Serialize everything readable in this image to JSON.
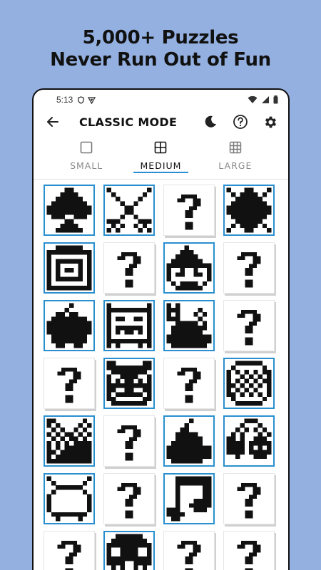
{
  "promo": {
    "line1": "5,000+ Puzzles",
    "line2": "Never Run Out of Fun"
  },
  "status_bar": {
    "time": "5:13",
    "icons": [
      "shield-icon",
      "vpn-icon",
      "wifi-icon",
      "signal-icon",
      "battery-icon"
    ]
  },
  "appbar": {
    "title": "CLASSIC MODE",
    "back_icon": "arrow-left-icon",
    "actions": [
      "dark-mode-icon",
      "help-icon",
      "settings-icon"
    ]
  },
  "tabs": [
    {
      "label": "SMALL",
      "icon": "grid-1-icon",
      "active": false
    },
    {
      "label": "MEDIUM",
      "icon": "grid-2-icon",
      "active": true
    },
    {
      "label": "LARGE",
      "icon": "grid-3-icon",
      "active": false
    }
  ],
  "puzzles": [
    {
      "solved": true,
      "pic": "spade"
    },
    {
      "solved": true,
      "pic": "crossed-swords"
    },
    {
      "solved": false,
      "pic": "?"
    },
    {
      "solved": true,
      "pic": "sun"
    },
    {
      "solved": true,
      "pic": "target-box"
    },
    {
      "solved": false,
      "pic": "?"
    },
    {
      "solved": true,
      "pic": "wizard"
    },
    {
      "solved": false,
      "pic": "?"
    },
    {
      "solved": true,
      "pic": "apple"
    },
    {
      "solved": true,
      "pic": "robot"
    },
    {
      "solved": true,
      "pic": "cat"
    },
    {
      "solved": false,
      "pic": "?"
    },
    {
      "solved": false,
      "pic": "?"
    },
    {
      "solved": true,
      "pic": "bear"
    },
    {
      "solved": false,
      "pic": "?"
    },
    {
      "solved": true,
      "pic": "pill"
    },
    {
      "solved": true,
      "pic": "chocolate"
    },
    {
      "solved": false,
      "pic": "?"
    },
    {
      "solved": true,
      "pic": "pear"
    },
    {
      "solved": true,
      "pic": "cherries"
    },
    {
      "solved": true,
      "pic": "tv"
    },
    {
      "solved": false,
      "pic": "?"
    },
    {
      "solved": true,
      "pic": "music-note"
    },
    {
      "solved": false,
      "pic": "?"
    },
    {
      "solved": false,
      "pic": "?"
    },
    {
      "solved": true,
      "pic": "skull"
    },
    {
      "solved": false,
      "pic": "?"
    },
    {
      "solved": false,
      "pic": "?"
    }
  ]
}
